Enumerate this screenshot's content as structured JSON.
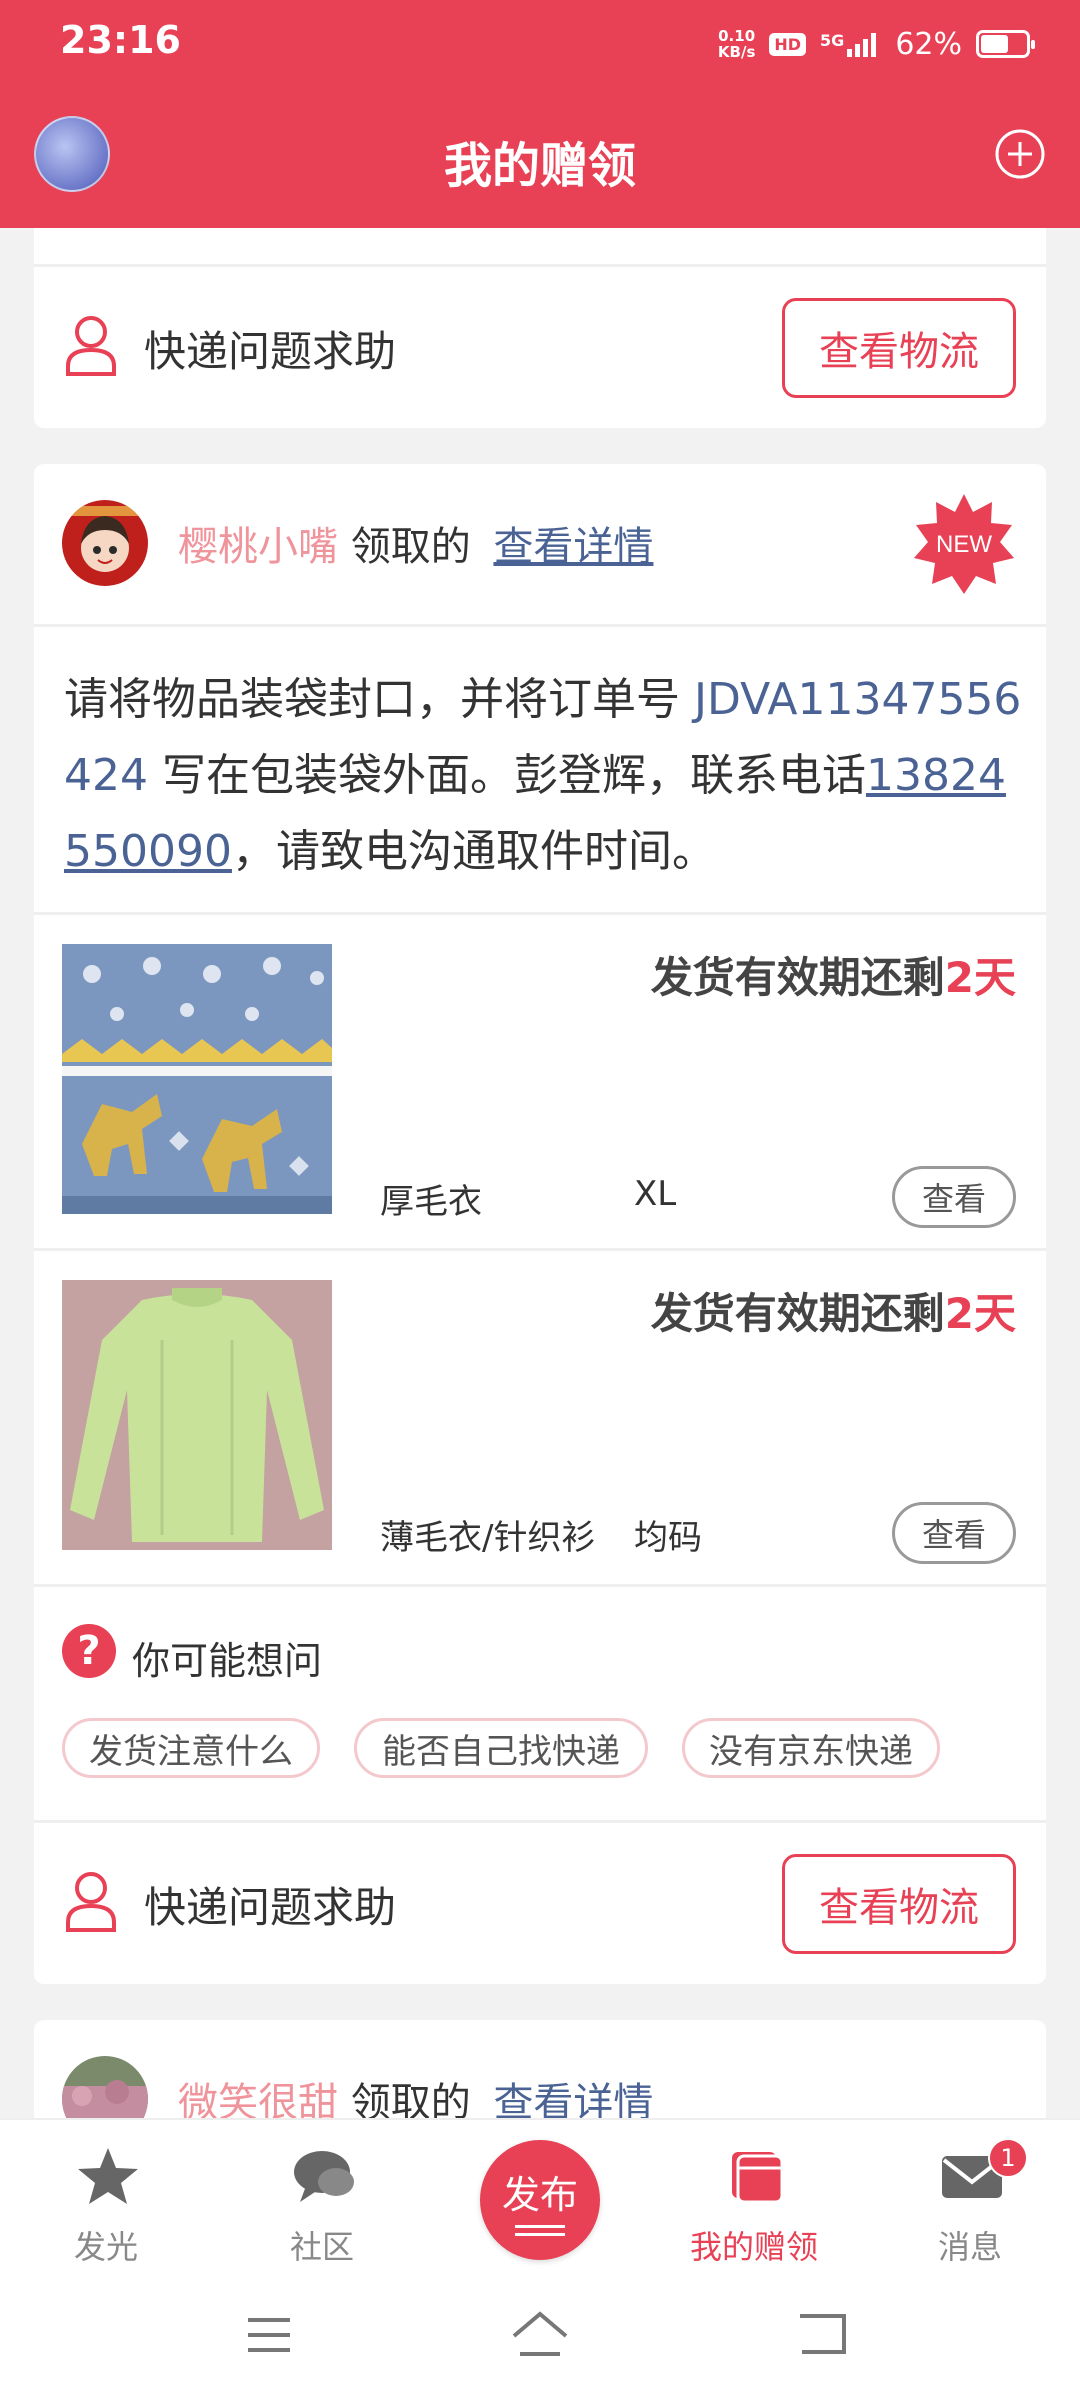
{
  "status_bar": {
    "time": "23:16",
    "net_speed_value": "0.10",
    "net_speed_unit": "KB/s",
    "hd": "HD",
    "signal": "5G",
    "battery_percent": "62%",
    "battery_level": 0.62
  },
  "header": {
    "title": "我的赠领"
  },
  "card_top": {
    "help_text": "快递问题求助",
    "logistics_button": "查看物流"
  },
  "card_main": {
    "giver_name": "樱桃小嘴",
    "claimed_text": "领取的",
    "detail_link": "查看详情",
    "new_badge": "NEW",
    "message_part1": "请将物品装袋封口，并将订单号 ",
    "order_no": "JDVA11347556424",
    "message_part2": " 写在包装袋外面。彭登辉，联系电话",
    "phone": "13824550090",
    "message_part3": "，请致电沟通取件时间。",
    "items": [
      {
        "deadline_prefix": "发货有效期还剩",
        "deadline_days": "2天",
        "name": "厚毛衣",
        "size": "XL",
        "view_button": "查看"
      },
      {
        "deadline_prefix": "发货有效期还剩",
        "deadline_days": "2天",
        "name": "薄毛衣/针织衫",
        "size": "均码",
        "view_button": "查看"
      }
    ],
    "faq_icon": "?",
    "faq_title": "你可能想问",
    "faq_chips": [
      "发货注意什么",
      "能否自己找快递",
      "没有京东快递"
    ],
    "help_text": "快递问题求助",
    "logistics_button": "查看物流"
  },
  "card_next": {
    "giver_name": "微笑很甜",
    "claimed_text": "领取的",
    "detail_link": "查看详情"
  },
  "tabbar": {
    "tabs": [
      {
        "label": "发光",
        "icon": "star-icon"
      },
      {
        "label": "社区",
        "icon": "chat-bubble-icon"
      },
      {
        "label": "发布",
        "icon": "publish-icon"
      },
      {
        "label": "我的赠领",
        "icon": "gift-box-icon"
      },
      {
        "label": "消息",
        "icon": "mail-icon"
      }
    ],
    "message_badge": "1",
    "active_color": "#e84155"
  },
  "colors": {
    "brand": "#e84155",
    "link": "#4a6394",
    "giver_name": "#f0949c"
  }
}
